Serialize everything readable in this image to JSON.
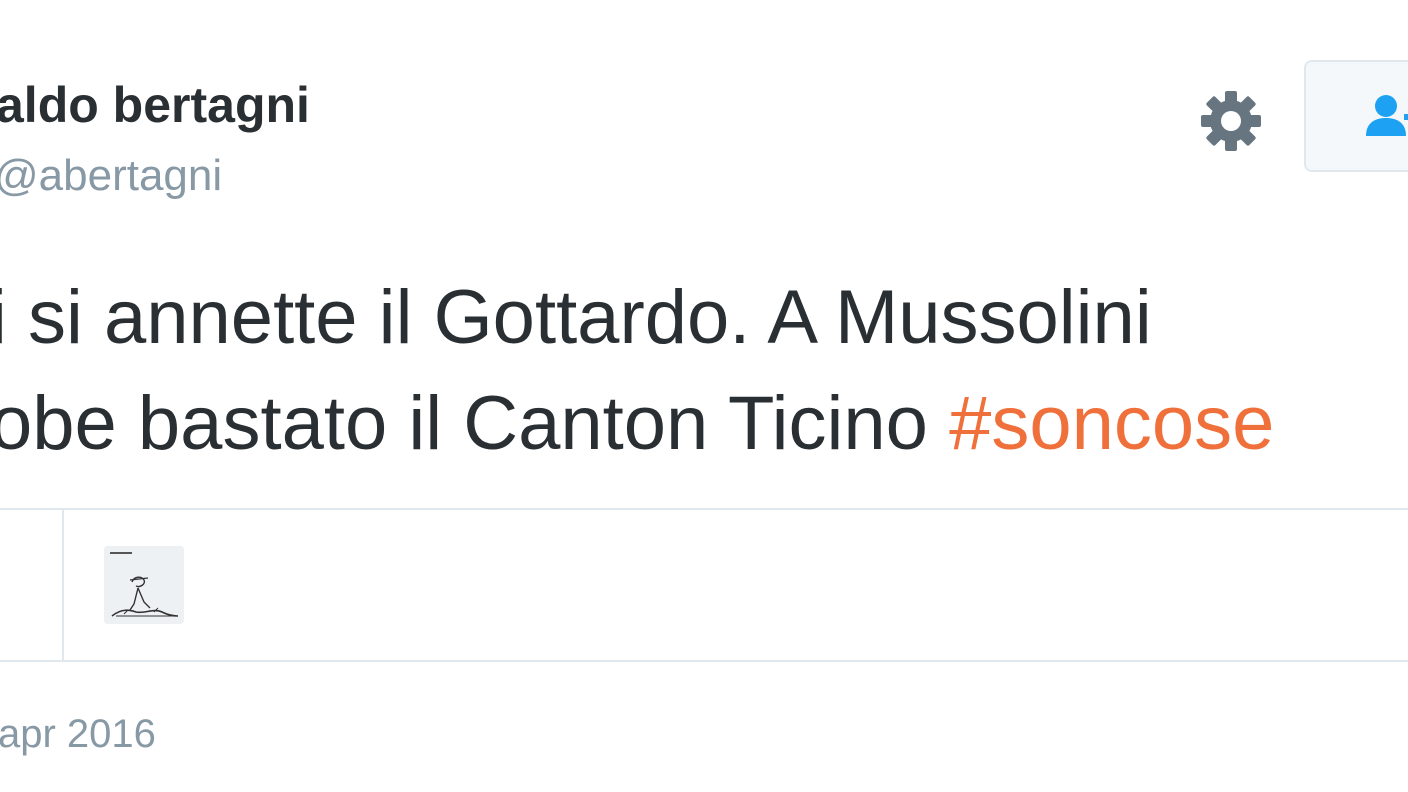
{
  "user": {
    "name": "aldo bertagni",
    "handle": "@abertagni"
  },
  "tweet": {
    "line1": "i si annette il Gottardo. A Mussolini",
    "line2_text": "obe bastato il Canton Ticino ",
    "hashtag": "#soncose"
  },
  "icons": {
    "settings": "gear-icon",
    "follow": "add-user-icon",
    "media": "cartoon-thumbnail"
  },
  "meta": {
    "date": "apr 2016"
  },
  "colors": {
    "text": "#292f33",
    "muted": "#8899a6",
    "hashtag": "#f0703b",
    "follow_icon": "#1da1f2",
    "border": "#e1e8ed"
  }
}
